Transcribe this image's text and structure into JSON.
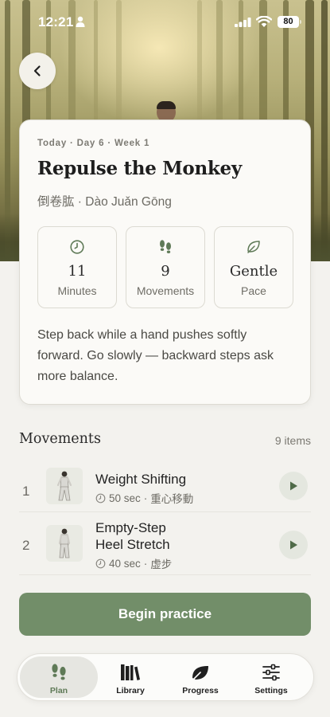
{
  "status_bar": {
    "time": "12:21",
    "battery": "80"
  },
  "colors": {
    "accent": "#728e69",
    "background": "#f3f2ee",
    "card": "#fbfaf7"
  },
  "header": {
    "back_icon": "chevron-left-icon"
  },
  "session": {
    "eyebrow": "Today · Day 6 · Week 1",
    "title": "Repulse the Monkey",
    "subtitle": "倒卷肱 · Dào Juǎn Gōng",
    "stats": [
      {
        "icon": "clock-icon",
        "value": "11",
        "label": "Minutes"
      },
      {
        "icon": "footprints-icon",
        "value": "9",
        "label": "Movements"
      },
      {
        "icon": "leaf-icon",
        "value": "Gentle",
        "label": "Pace"
      }
    ],
    "description": "Step back while a hand pushes softly forward. Go slowly — backward steps ask more balance."
  },
  "movements": {
    "heading": "Movements",
    "count": "9 items",
    "items": [
      {
        "number": "1",
        "name": "Weight Shifting",
        "duration": "50 sec",
        "chinese": "重心移動"
      },
      {
        "number": "2",
        "name": "Empty-Step Heel Stretch",
        "name_line1": "Empty-Step",
        "name_line2": "Heel Stretch",
        "duration": "40 sec",
        "chinese": "虚步"
      }
    ]
  },
  "actions": {
    "begin_label": "Begin practice"
  },
  "tabbar": {
    "tabs": [
      {
        "label": "Plan",
        "icon": "footprints-icon",
        "active": true
      },
      {
        "label": "Library",
        "icon": "books-icon",
        "active": false
      },
      {
        "label": "Progress",
        "icon": "leaf-icon",
        "active": false
      },
      {
        "label": "Settings",
        "icon": "sliders-icon",
        "active": false
      }
    ]
  }
}
